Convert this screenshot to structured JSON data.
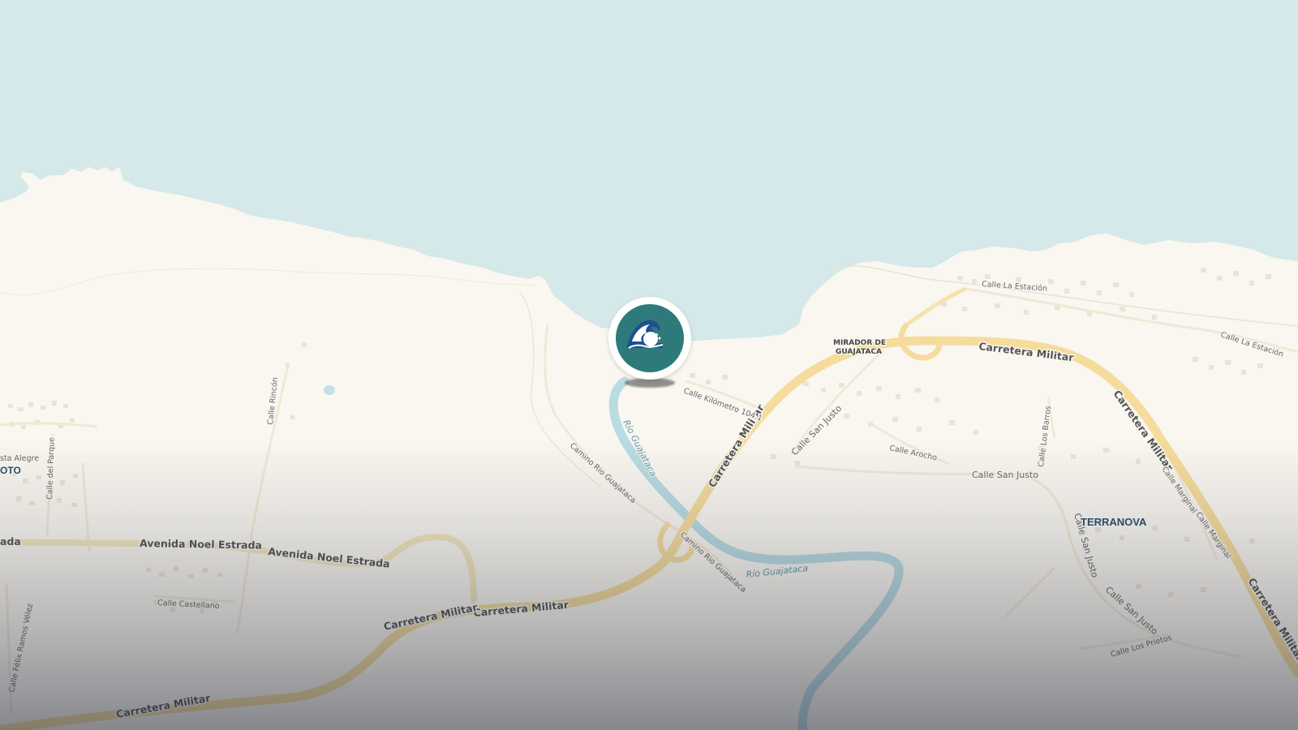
{
  "map": {
    "colors": {
      "water": "#d5e8ea",
      "land": "#faf7f0",
      "highway": "#f5dc9c",
      "river": "#b9dbe2",
      "marker": "#2e7a7b"
    },
    "marker": {
      "icon": "ocean-wave-icon"
    },
    "places": {
      "terranova": "TERRANOVA",
      "oto": "OTO"
    },
    "pois": {
      "mirador_line1": "MIRADOR DE",
      "mirador_line2": "GUAJATACA"
    },
    "water_labels": {
      "rio_1": "Río Guajataca",
      "rio_2": "Río Guajataca"
    },
    "roads": {
      "militar_1": "Carretera Militar",
      "militar_2": "Carretera Militar",
      "militar_3": "Carretera Militar",
      "militar_4": "Carretera Militar",
      "militar_5": "Carretera Militar",
      "militar_6": "Carretera Militar",
      "militar_7": "Carretera Militar",
      "noel_1": "Avenida Noel Estrada",
      "noel_2": "Avenida Noel Estrada",
      "noel_3": "ada",
      "km104": "Calle Kilómetro 104.1",
      "camino_rio_1": "Camino Rio Guajataca",
      "camino_rio_2": "Camino Rio Guajataca",
      "san_justo_1": "Calle San Justo",
      "san_justo_2": "Calle San Justo",
      "san_justo_3": "Calle San Justo",
      "san_justo_4": "Calle San Justo",
      "arocho": "Calle Arocho",
      "los_barros": "Calle Los Barros",
      "la_estacion_1": "Calle La Estación",
      "la_estacion_2": "Calle La Estación",
      "marginal_1": "Calle Marginal",
      "marginal_2": "Calle Marginal",
      "los_prietos": "Calle Los Prietos",
      "rincon": "Calle Rincón",
      "del_parque": "Calle del Parque",
      "castellano": "Calle Castellano",
      "felix_ramos": "Calle Félix Ramos Vélez",
      "sta_alegre": "sta Alegre"
    }
  }
}
